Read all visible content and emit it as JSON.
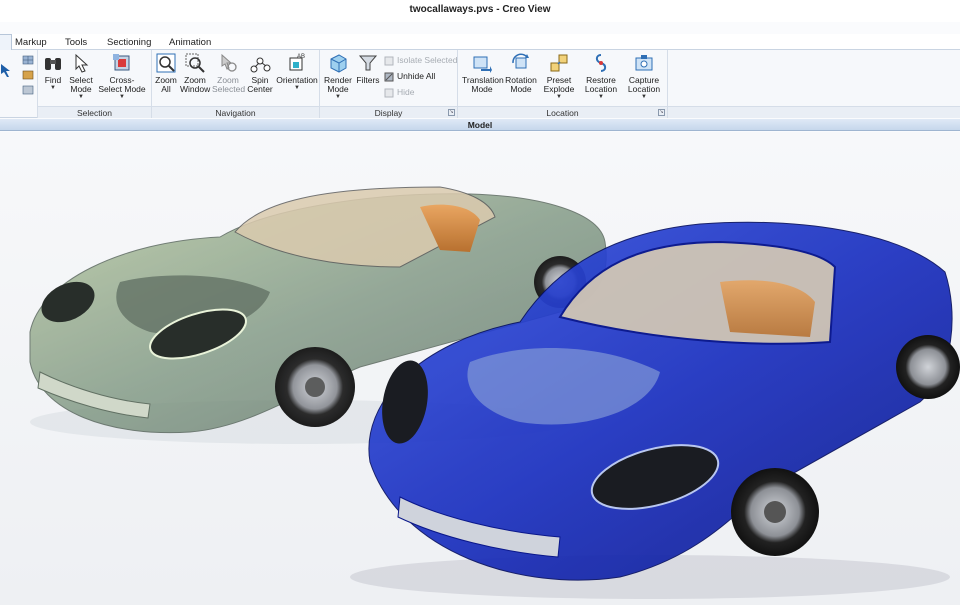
{
  "window": {
    "title": "twocallaways.pvs - Creo View"
  },
  "tabs": [
    "Markup",
    "Tools",
    "Sectioning",
    "Animation"
  ],
  "ribbon": {
    "selection": {
      "label": "Selection",
      "find": "Find",
      "select_mode": "Select Mode",
      "cross_select_mode": "Cross-Select Mode"
    },
    "navigation": {
      "label": "Navigation",
      "zoom_all": "Zoom All",
      "zoom_window": "Zoom Window",
      "zoom_selected": "Zoom Selected",
      "spin_center": "Spin Center",
      "orientation": "Orientation"
    },
    "display": {
      "label": "Display",
      "render_mode": "Render Mode",
      "filters": "Filters",
      "isolate_selected": "Isolate Selected",
      "unhide_all": "Unhide All",
      "hide": "Hide"
    },
    "location": {
      "label": "Location",
      "translation_mode": "Translation Mode",
      "rotation_mode": "Rotation Mode",
      "preset_explode": "Preset Explode",
      "restore_location": "Restore Location",
      "capture_location": "Capture Location"
    }
  },
  "model_bar": {
    "label": "Model"
  },
  "colors": {
    "accent": "#2f6fb5",
    "car_green": "#7a9a6a",
    "car_blue": "#1530c0"
  }
}
